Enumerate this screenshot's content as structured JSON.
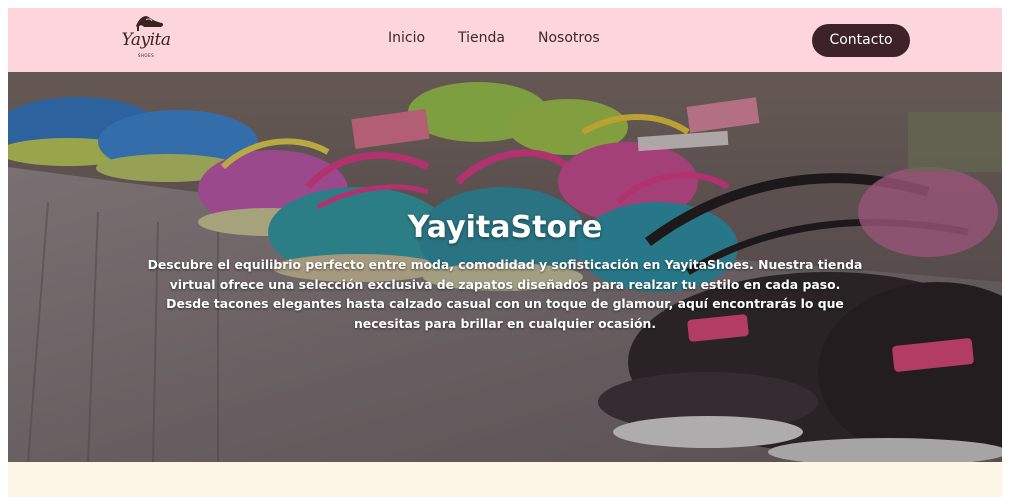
{
  "brand": {
    "logo_text": "Yayita",
    "logo_subtext": "SHOES"
  },
  "nav": {
    "links": [
      {
        "label": "Inicio"
      },
      {
        "label": "Tienda"
      },
      {
        "label": "Nosotros"
      }
    ],
    "contact_label": "Contacto"
  },
  "hero": {
    "title": "YayitaStore",
    "description": "Descubre el equilibrio perfecto entre moda, comodidad y sofisticación en YayitaShoes. Nuestra tienda virtual ofrece una selección exclusiva de zapatos diseñados para realzar tu estilo en cada paso. Desde tacones elegantes hasta calzado casual con un toque de glamour, aquí encontrarás lo que necesitas para brillar en cualquier ocasión."
  },
  "colors": {
    "navbar_bg": "#fcd5dd",
    "contact_bg": "#3d2227",
    "page_bg": "#fdf5e6"
  }
}
